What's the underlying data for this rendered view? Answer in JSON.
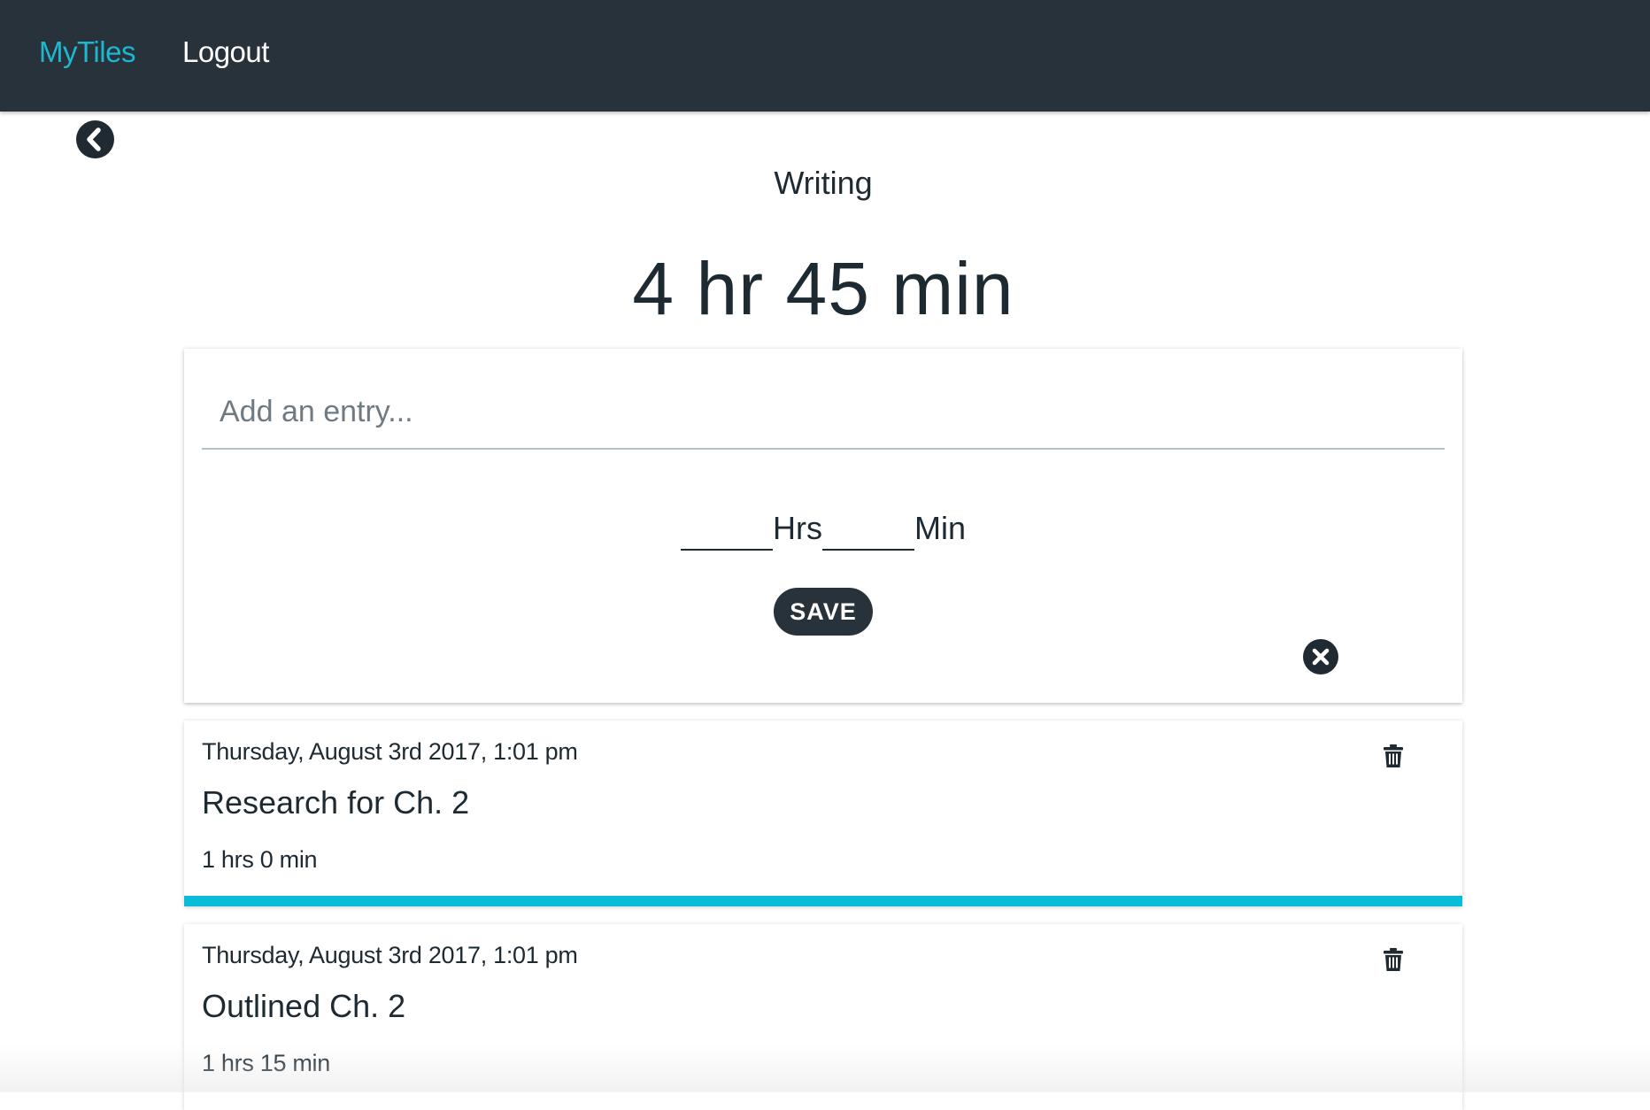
{
  "nav": {
    "brand": "MyTiles",
    "logout": "Logout"
  },
  "back_icon": "chevron-left-circle-icon",
  "tile": {
    "title": "Writing",
    "total": "4 hr 45 min"
  },
  "form": {
    "entry_placeholder": "Add an entry...",
    "entry_value": "",
    "hours_value": "",
    "hours_label": "Hrs",
    "minutes_value": "",
    "minutes_label": "Min",
    "save_label": "SAVE",
    "close_icon": "close-circle-icon"
  },
  "entries": [
    {
      "date": "Thursday, August 3rd 2017, 1:01 pm",
      "title": "Research for Ch. 2",
      "duration": "1 hrs 0 min",
      "delete_icon": "trash-icon"
    },
    {
      "date": "Thursday, August 3rd 2017, 1:01 pm",
      "title": "Outlined Ch. 2",
      "duration": "1 hrs 15 min",
      "delete_icon": "trash-icon"
    }
  ],
  "colors": {
    "navbar": "#27323b",
    "brand": "#1eb7d0",
    "accent_bar": "#09bcd8",
    "text": "#1e2a32"
  }
}
